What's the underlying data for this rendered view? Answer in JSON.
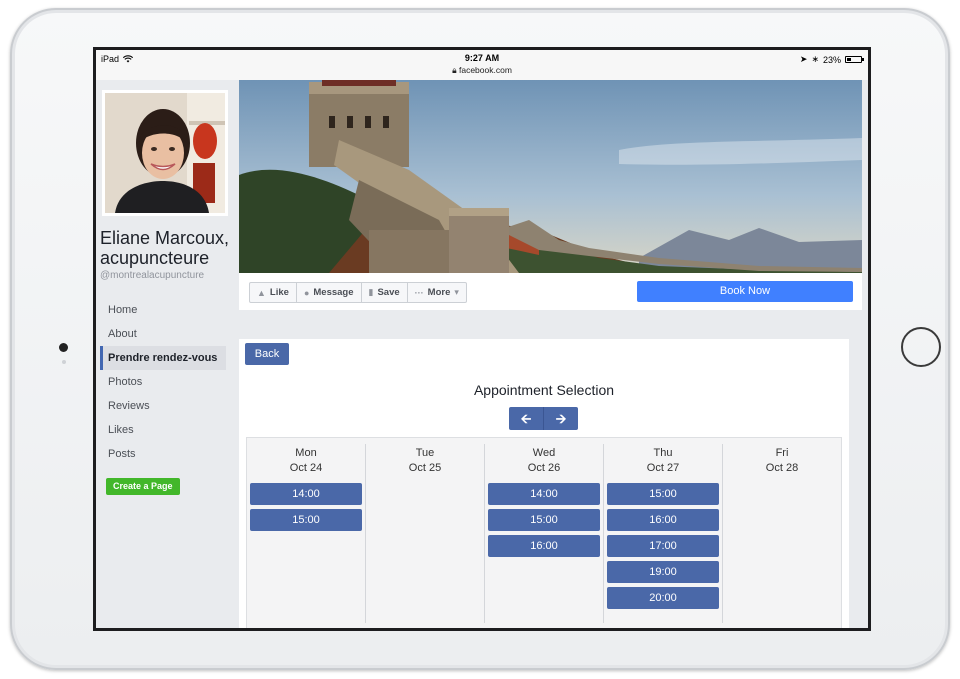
{
  "status_bar": {
    "device": "iPad",
    "time": "9:27 AM",
    "url": "facebook.com",
    "battery": "23%"
  },
  "profile": {
    "name": "Eliane Marcoux, acupuncteure",
    "handle": "@montrealacupuncture"
  },
  "nav": {
    "items": [
      {
        "label": "Home"
      },
      {
        "label": "About"
      },
      {
        "label": "Prendre rendez-vous"
      },
      {
        "label": "Photos"
      },
      {
        "label": "Reviews"
      },
      {
        "label": "Likes"
      },
      {
        "label": "Posts"
      }
    ],
    "active_index": 2,
    "create_page": "Create a Page"
  },
  "actions": {
    "like": "Like",
    "message": "Message",
    "save": "Save",
    "more": "More",
    "book_now": "Book Now"
  },
  "appointment": {
    "back": "Back",
    "title": "Appointment Selection",
    "prev_icon": "arrow-left-icon",
    "next_icon": "arrow-right-icon",
    "days": [
      {
        "name": "Mon",
        "date": "Oct 24",
        "slots": [
          "14:00",
          "15:00"
        ]
      },
      {
        "name": "Tue",
        "date": "Oct 25",
        "slots": []
      },
      {
        "name": "Wed",
        "date": "Oct 26",
        "slots": [
          "14:00",
          "15:00",
          "16:00"
        ]
      },
      {
        "name": "Thu",
        "date": "Oct 27",
        "slots": [
          "15:00",
          "16:00",
          "17:00",
          "19:00",
          "20:00"
        ]
      },
      {
        "name": "Fri",
        "date": "Oct 28",
        "slots": []
      }
    ]
  },
  "colors": {
    "facebook_blue": "#4a68a8",
    "book_now_blue": "#4080ff",
    "create_page_green": "#42b72a"
  }
}
